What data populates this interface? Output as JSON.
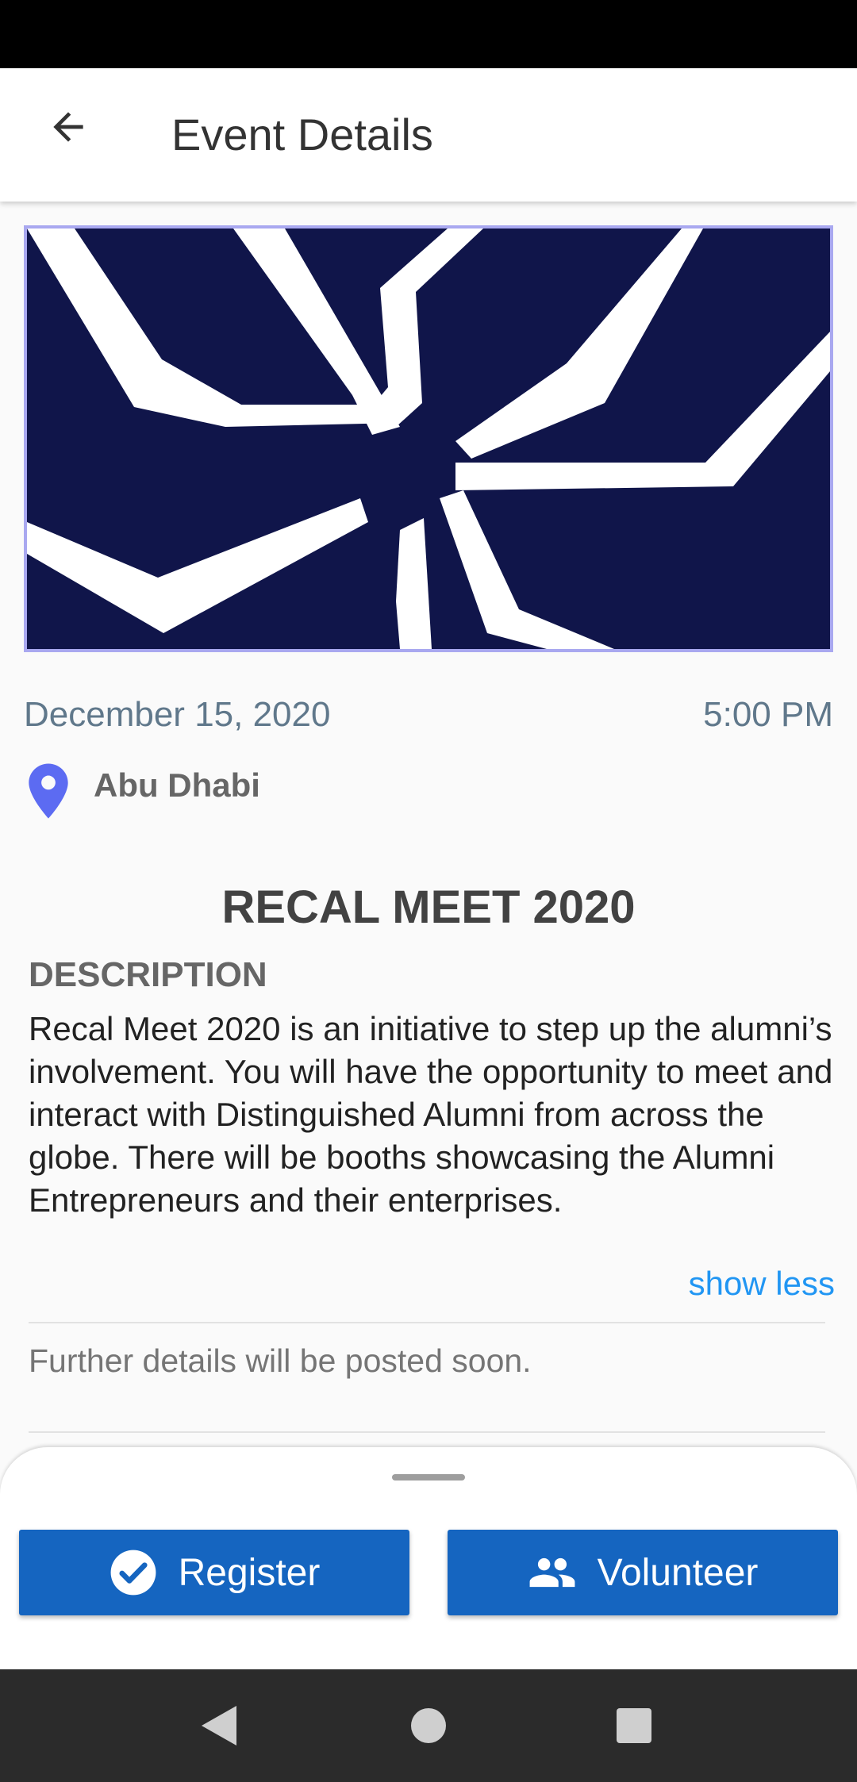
{
  "app_bar": {
    "title": "Event Details",
    "back_icon": "arrow-back-icon"
  },
  "event": {
    "date": "December 15, 2020",
    "time": "5:00 PM",
    "location": "Abu Dhabi",
    "title": "RECAL MEET 2020",
    "description_heading": "DESCRIPTION",
    "description": "Recal Meet 2020 is an initiative to step up the alumni’s involvement. You will have the opportunity to meet and interact with Distinguished Alumni from across the globe. There will be booths showcasing the Alumni Entrepreneurs and their enterprises.",
    "show_less_label": "show less",
    "further_details": "Further details will be posted soon."
  },
  "actions": {
    "register_label": "Register",
    "volunteer_label": "Volunteer"
  },
  "colors": {
    "primary_button": "#1565c0",
    "link": "#2196f3",
    "banner_background": "#10154a",
    "location_pin": "#5c6bf2"
  },
  "system_nav": {
    "back_icon": "triangle-back-icon",
    "home_icon": "circle-home-icon",
    "recents_icon": "square-recents-icon"
  }
}
